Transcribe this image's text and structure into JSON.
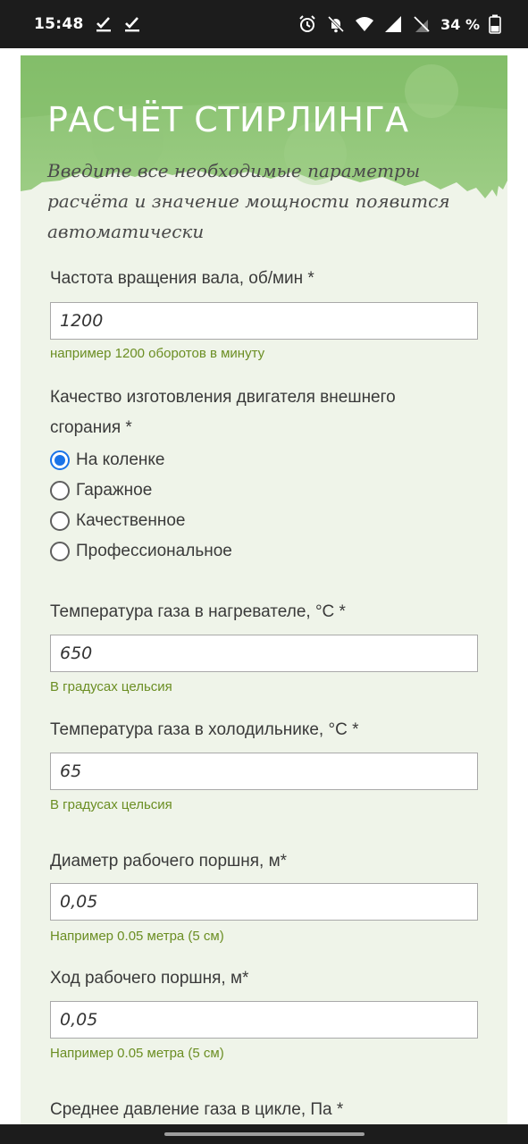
{
  "status_bar": {
    "time": "15:48",
    "battery_text": "34 %",
    "icons": [
      "check-icon",
      "check-icon",
      "alarm-icon",
      "notifications-off-icon",
      "wifi-icon",
      "signal-icon",
      "no-sim-icon",
      "battery-icon"
    ]
  },
  "form": {
    "title": "РАСЧЁТ СТИРЛИНГА",
    "description": "Введите все необходимые параметры расчёта и значение мощности появится автоматически",
    "header_color": "#8cc474",
    "background_color": "#eff4e9",
    "hint_color": "#6b8e23"
  },
  "fields": {
    "shaft_speed": {
      "label": "Частота вращения вала, об/мин *",
      "value": "1200",
      "hint": "например 1200 оборотов в минуту"
    },
    "quality": {
      "label": "Качество изготовления двигателя внешнего сгорания *",
      "options": [
        "На коленке",
        "Гаражное",
        "Качественное",
        "Профессиональное"
      ],
      "selected_index": 0
    },
    "heater_temp": {
      "label": "Температура газа в нагревателе, °C *",
      "value": "650",
      "hint": "В градусах цельсия"
    },
    "cooler_temp": {
      "label": "Температура газа в холодильнике, °C *",
      "value": "65",
      "hint": "В градусах цельсия"
    },
    "piston_diameter": {
      "label": "Диаметр рабочего поршня, м*",
      "value": "0,05",
      "hint": "Например 0.05 метра (5 см)"
    },
    "piston_stroke": {
      "label": "Ход рабочего поршня, м*",
      "value": "0,05",
      "hint": "Например 0.05 метра (5 см)"
    },
    "mean_pressure": {
      "label": "Среднее давление газа в цикле, Па *"
    }
  }
}
